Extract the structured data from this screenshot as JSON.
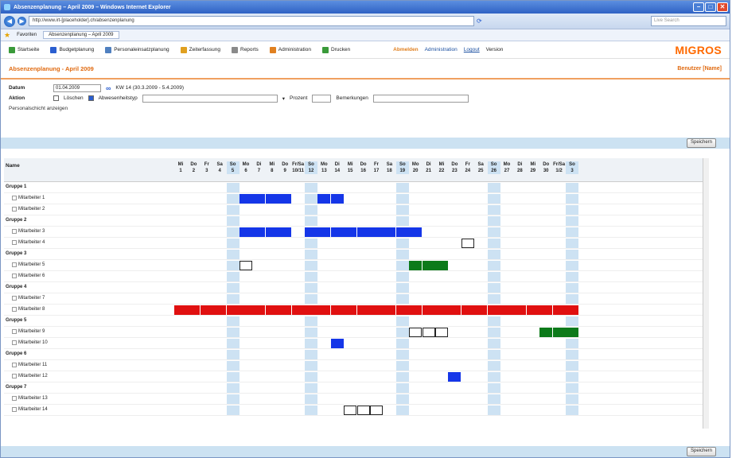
{
  "browser": {
    "title": "Absenzenplanung – April 2009 – Windows Internet Explorer",
    "url": "http://www.irt-[placeholder].ch/absenzenplanung",
    "search_placeholder": "Live Search",
    "favorites_label": "Favoriten",
    "tab_label": "Absenzenplanung – April 2009"
  },
  "appnav": {
    "items": [
      "Startseite",
      "Budgetplanung",
      "Personaleinsatzplanung",
      "Zeiterfassung",
      "Reports",
      "Administration",
      "Drucken"
    ],
    "right": [
      "Abmelden",
      "Administration",
      "Logout",
      "Version"
    ],
    "brand": "MIGROS"
  },
  "page": {
    "title": "Absenzenplanung - April 2009",
    "user": "Benutzer [Name]"
  },
  "filters": {
    "datum_label": "Datum",
    "datum_value": "01.04.2009",
    "range_text": "KW 14 (30.3.2009 - 5.4.2009)",
    "aktion_label": "Aktion",
    "cb1_label": "Löschen",
    "cb2_label": "Abwesenheitstyp",
    "prozent_label": "Prozent",
    "bemerkung_label": "Bemerkungen",
    "link_text": "Personalschicht anzeigen"
  },
  "buttons": {
    "top": "Speichern",
    "bottom": "Speichern"
  },
  "grid": {
    "name_header": "Name",
    "days": [
      {
        "d": "Mi",
        "n": "1"
      },
      {
        "d": "Do",
        "n": "2"
      },
      {
        "d": "Fr",
        "n": "3"
      },
      {
        "d": "Sa",
        "n": "4"
      },
      {
        "d": "So",
        "n": "5"
      },
      {
        "d": "Mo",
        "n": "6"
      },
      {
        "d": "Di",
        "n": "7"
      },
      {
        "d": "Mi",
        "n": "8"
      },
      {
        "d": "Do",
        "n": "9"
      },
      {
        "d": "Fr/Sa",
        "n": "10/11"
      },
      {
        "d": "So",
        "n": "12"
      },
      {
        "d": "Mo",
        "n": "13"
      },
      {
        "d": "Di",
        "n": "14"
      },
      {
        "d": "Mi",
        "n": "15"
      },
      {
        "d": "Do",
        "n": "16"
      },
      {
        "d": "Fr",
        "n": "17"
      },
      {
        "d": "Sa",
        "n": "18"
      },
      {
        "d": "So",
        "n": "19"
      },
      {
        "d": "Mo",
        "n": "20"
      },
      {
        "d": "Di",
        "n": "21"
      },
      {
        "d": "Mi",
        "n": "22"
      },
      {
        "d": "Do",
        "n": "23"
      },
      {
        "d": "Fr",
        "n": "24"
      },
      {
        "d": "Sa",
        "n": "25"
      },
      {
        "d": "So",
        "n": "26"
      },
      {
        "d": "Mo",
        "n": "27"
      },
      {
        "d": "Di",
        "n": "28"
      },
      {
        "d": "Mi",
        "n": "29"
      },
      {
        "d": "Do",
        "n": "30"
      },
      {
        "d": "Fr/Sa",
        "n": "1/2"
      },
      {
        "d": "So",
        "n": "3"
      }
    ],
    "rows": [
      {
        "type": "group",
        "label": "Gruppe 1"
      },
      {
        "type": "person",
        "label": "Mitarbeiter 1"
      },
      {
        "type": "person",
        "label": "Mitarbeiter 2"
      },
      {
        "type": "group",
        "label": "Gruppe 2"
      },
      {
        "type": "person",
        "label": "Mitarbeiter 3"
      },
      {
        "type": "person",
        "label": "Mitarbeiter 4"
      },
      {
        "type": "group",
        "label": "Gruppe 3"
      },
      {
        "type": "person",
        "label": "Mitarbeiter 5"
      },
      {
        "type": "person",
        "label": "Mitarbeiter 6"
      },
      {
        "type": "group",
        "label": "Gruppe 4"
      },
      {
        "type": "person",
        "label": "Mitarbeiter 7"
      },
      {
        "type": "person",
        "label": "Mitarbeiter 8"
      },
      {
        "type": "group",
        "label": "Gruppe 5"
      },
      {
        "type": "person",
        "label": "Mitarbeiter 9"
      },
      {
        "type": "person",
        "label": "Mitarbeiter 10"
      },
      {
        "type": "group",
        "label": "Gruppe 6"
      },
      {
        "type": "person",
        "label": "Mitarbeiter 11"
      },
      {
        "type": "person",
        "label": "Mitarbeiter 12"
      },
      {
        "type": "group",
        "label": "Gruppe 7"
      },
      {
        "type": "person",
        "label": "Mitarbeiter 13"
      },
      {
        "type": "person",
        "label": "Mitarbeiter 14"
      }
    ],
    "colors": {
      "absence": "#1536e8",
      "sick": "#e01010",
      "ok": "#0c7a1a",
      "weekend": "#cde2f3"
    }
  }
}
